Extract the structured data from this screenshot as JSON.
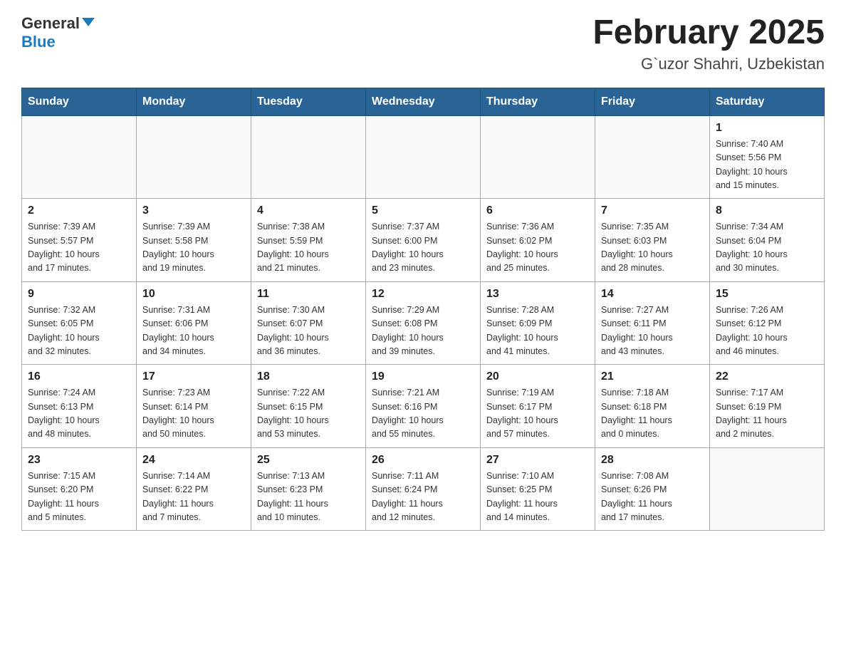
{
  "header": {
    "logo": {
      "general": "General",
      "blue": "Blue"
    },
    "title": "February 2025",
    "location": "G`uzor Shahri, Uzbekistan"
  },
  "weekdays": [
    "Sunday",
    "Monday",
    "Tuesday",
    "Wednesday",
    "Thursday",
    "Friday",
    "Saturday"
  ],
  "weeks": [
    [
      {
        "day": "",
        "info": ""
      },
      {
        "day": "",
        "info": ""
      },
      {
        "day": "",
        "info": ""
      },
      {
        "day": "",
        "info": ""
      },
      {
        "day": "",
        "info": ""
      },
      {
        "day": "",
        "info": ""
      },
      {
        "day": "1",
        "info": "Sunrise: 7:40 AM\nSunset: 5:56 PM\nDaylight: 10 hours\nand 15 minutes."
      }
    ],
    [
      {
        "day": "2",
        "info": "Sunrise: 7:39 AM\nSunset: 5:57 PM\nDaylight: 10 hours\nand 17 minutes."
      },
      {
        "day": "3",
        "info": "Sunrise: 7:39 AM\nSunset: 5:58 PM\nDaylight: 10 hours\nand 19 minutes."
      },
      {
        "day": "4",
        "info": "Sunrise: 7:38 AM\nSunset: 5:59 PM\nDaylight: 10 hours\nand 21 minutes."
      },
      {
        "day": "5",
        "info": "Sunrise: 7:37 AM\nSunset: 6:00 PM\nDaylight: 10 hours\nand 23 minutes."
      },
      {
        "day": "6",
        "info": "Sunrise: 7:36 AM\nSunset: 6:02 PM\nDaylight: 10 hours\nand 25 minutes."
      },
      {
        "day": "7",
        "info": "Sunrise: 7:35 AM\nSunset: 6:03 PM\nDaylight: 10 hours\nand 28 minutes."
      },
      {
        "day": "8",
        "info": "Sunrise: 7:34 AM\nSunset: 6:04 PM\nDaylight: 10 hours\nand 30 minutes."
      }
    ],
    [
      {
        "day": "9",
        "info": "Sunrise: 7:32 AM\nSunset: 6:05 PM\nDaylight: 10 hours\nand 32 minutes."
      },
      {
        "day": "10",
        "info": "Sunrise: 7:31 AM\nSunset: 6:06 PM\nDaylight: 10 hours\nand 34 minutes."
      },
      {
        "day": "11",
        "info": "Sunrise: 7:30 AM\nSunset: 6:07 PM\nDaylight: 10 hours\nand 36 minutes."
      },
      {
        "day": "12",
        "info": "Sunrise: 7:29 AM\nSunset: 6:08 PM\nDaylight: 10 hours\nand 39 minutes."
      },
      {
        "day": "13",
        "info": "Sunrise: 7:28 AM\nSunset: 6:09 PM\nDaylight: 10 hours\nand 41 minutes."
      },
      {
        "day": "14",
        "info": "Sunrise: 7:27 AM\nSunset: 6:11 PM\nDaylight: 10 hours\nand 43 minutes."
      },
      {
        "day": "15",
        "info": "Sunrise: 7:26 AM\nSunset: 6:12 PM\nDaylight: 10 hours\nand 46 minutes."
      }
    ],
    [
      {
        "day": "16",
        "info": "Sunrise: 7:24 AM\nSunset: 6:13 PM\nDaylight: 10 hours\nand 48 minutes."
      },
      {
        "day": "17",
        "info": "Sunrise: 7:23 AM\nSunset: 6:14 PM\nDaylight: 10 hours\nand 50 minutes."
      },
      {
        "day": "18",
        "info": "Sunrise: 7:22 AM\nSunset: 6:15 PM\nDaylight: 10 hours\nand 53 minutes."
      },
      {
        "day": "19",
        "info": "Sunrise: 7:21 AM\nSunset: 6:16 PM\nDaylight: 10 hours\nand 55 minutes."
      },
      {
        "day": "20",
        "info": "Sunrise: 7:19 AM\nSunset: 6:17 PM\nDaylight: 10 hours\nand 57 minutes."
      },
      {
        "day": "21",
        "info": "Sunrise: 7:18 AM\nSunset: 6:18 PM\nDaylight: 11 hours\nand 0 minutes."
      },
      {
        "day": "22",
        "info": "Sunrise: 7:17 AM\nSunset: 6:19 PM\nDaylight: 11 hours\nand 2 minutes."
      }
    ],
    [
      {
        "day": "23",
        "info": "Sunrise: 7:15 AM\nSunset: 6:20 PM\nDaylight: 11 hours\nand 5 minutes."
      },
      {
        "day": "24",
        "info": "Sunrise: 7:14 AM\nSunset: 6:22 PM\nDaylight: 11 hours\nand 7 minutes."
      },
      {
        "day": "25",
        "info": "Sunrise: 7:13 AM\nSunset: 6:23 PM\nDaylight: 11 hours\nand 10 minutes."
      },
      {
        "day": "26",
        "info": "Sunrise: 7:11 AM\nSunset: 6:24 PM\nDaylight: 11 hours\nand 12 minutes."
      },
      {
        "day": "27",
        "info": "Sunrise: 7:10 AM\nSunset: 6:25 PM\nDaylight: 11 hours\nand 14 minutes."
      },
      {
        "day": "28",
        "info": "Sunrise: 7:08 AM\nSunset: 6:26 PM\nDaylight: 11 hours\nand 17 minutes."
      },
      {
        "day": "",
        "info": ""
      }
    ]
  ]
}
